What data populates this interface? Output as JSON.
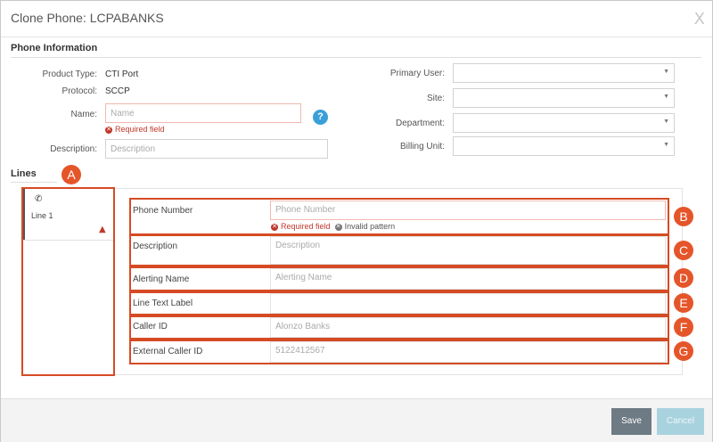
{
  "dialog": {
    "title": "Clone Phone: LCPABANKS",
    "close_label": "X"
  },
  "phone_info": {
    "section_label": "Phone Information",
    "product_type_label": "Product Type:",
    "product_type_value": "CTI Port",
    "protocol_label": "Protocol:",
    "protocol_value": "SCCP",
    "name_label": "Name:",
    "name_placeholder": "Name",
    "name_error": "Required field",
    "description_label": "Description:",
    "description_placeholder": "Description",
    "help_label": "?",
    "primary_user_label": "Primary User:",
    "site_label": "Site:",
    "department_label": "Department:",
    "billing_unit_label": "Billing Unit:"
  },
  "lines": {
    "section_label": "Lines",
    "tab_label": "Line 1",
    "phone_number_label": "Phone Number",
    "phone_number_placeholder": "Phone Number",
    "phone_number_error_required": "Required field",
    "phone_number_error_pattern": "Invalid pattern",
    "description_label": "Description",
    "description_placeholder": "Description",
    "alerting_name_label": "Alerting Name",
    "alerting_name_placeholder": "Alerting Name",
    "line_text_label_label": "Line Text Label",
    "caller_id_label": "Caller ID",
    "caller_id_placeholder": "Alonzo Banks",
    "external_caller_id_label": "External Caller ID",
    "external_caller_id_placeholder": "5122412567"
  },
  "callouts": {
    "a": "A",
    "b": "B",
    "c": "C",
    "d": "D",
    "e": "E",
    "f": "F",
    "g": "G"
  },
  "footer": {
    "save_label": "Save",
    "cancel_label": "Cancel"
  },
  "colors": {
    "accent_orange": "#e5552a",
    "error_red": "#c0392b",
    "save_button": "#6e7b84",
    "cancel_button": "#a9d2df",
    "help_blue": "#3a9fd8"
  },
  "icons": [
    "close-icon",
    "help-icon",
    "phone-icon",
    "warning-icon",
    "error-icon",
    "chevron-down-icon"
  ]
}
